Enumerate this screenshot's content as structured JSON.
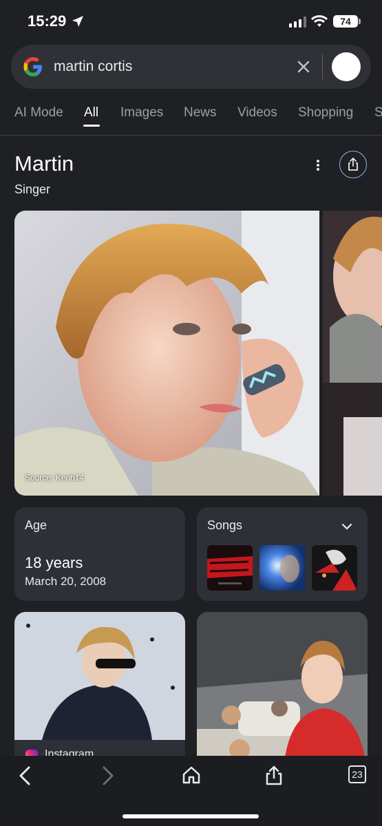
{
  "status": {
    "time": "15:29",
    "battery": "74"
  },
  "search": {
    "query": "martin cortis"
  },
  "tabs": [
    {
      "label": "AI Mode"
    },
    {
      "label": "All"
    },
    {
      "label": "Images"
    },
    {
      "label": "News"
    },
    {
      "label": "Videos"
    },
    {
      "label": "Shopping"
    },
    {
      "label": "S"
    }
  ],
  "active_tab": "All",
  "knowledge": {
    "title": "Martin",
    "subtitle": "Singer",
    "image_source": "Source: Kenh14",
    "age_label": "Age",
    "age_value": "18 years",
    "birth_date": "March 20, 2008",
    "songs_label": "Songs",
    "instagram_label": "Instagram"
  },
  "browser": {
    "tab_count": "23"
  },
  "icons": [
    "google-logo-icon",
    "location-arrow-icon",
    "signal-icon",
    "wifi-icon",
    "battery-icon",
    "clear-icon",
    "more-vertical-icon",
    "share-icon",
    "chevron-down-icon",
    "instagram-icon",
    "back-icon",
    "forward-icon",
    "home-icon",
    "tabs-icon"
  ],
  "colors": {
    "background": "#1f2024",
    "card": "#2e3038",
    "accent": "#8ab4f8"
  }
}
